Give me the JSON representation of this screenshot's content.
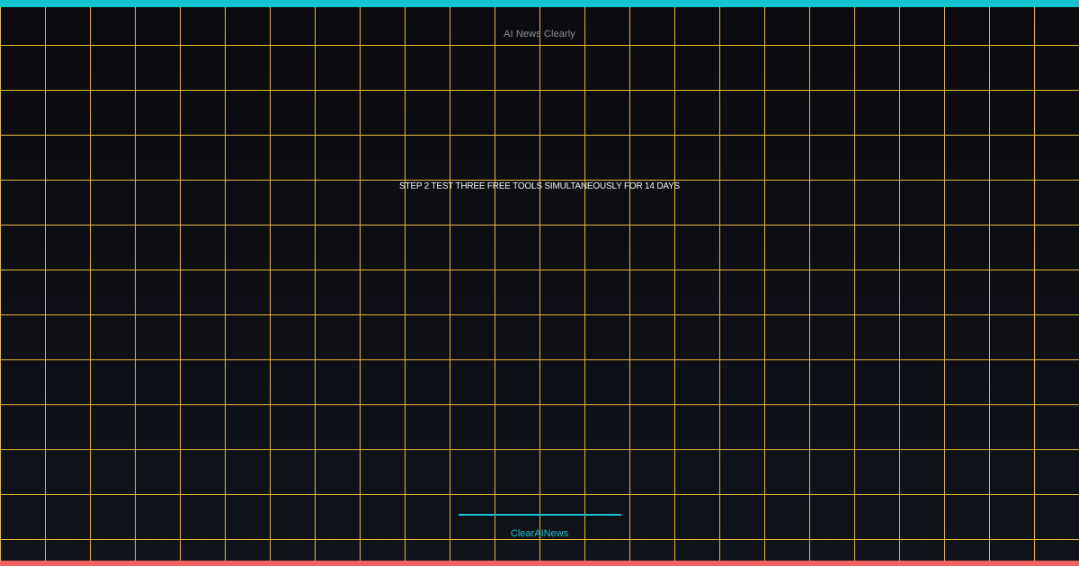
{
  "brand": {
    "title": "AI News Clearly",
    "footer": "ClearAINews"
  },
  "hero": {
    "headline": "STEP 2 TEST THREE FREE TOOLS SIMULTANEOUSLY FOR 14 DAYS"
  },
  "colors": {
    "accent": "#12c6cf",
    "grid": "#e6b836",
    "bottom_accent": "#f06060",
    "background": "#0f1117"
  }
}
